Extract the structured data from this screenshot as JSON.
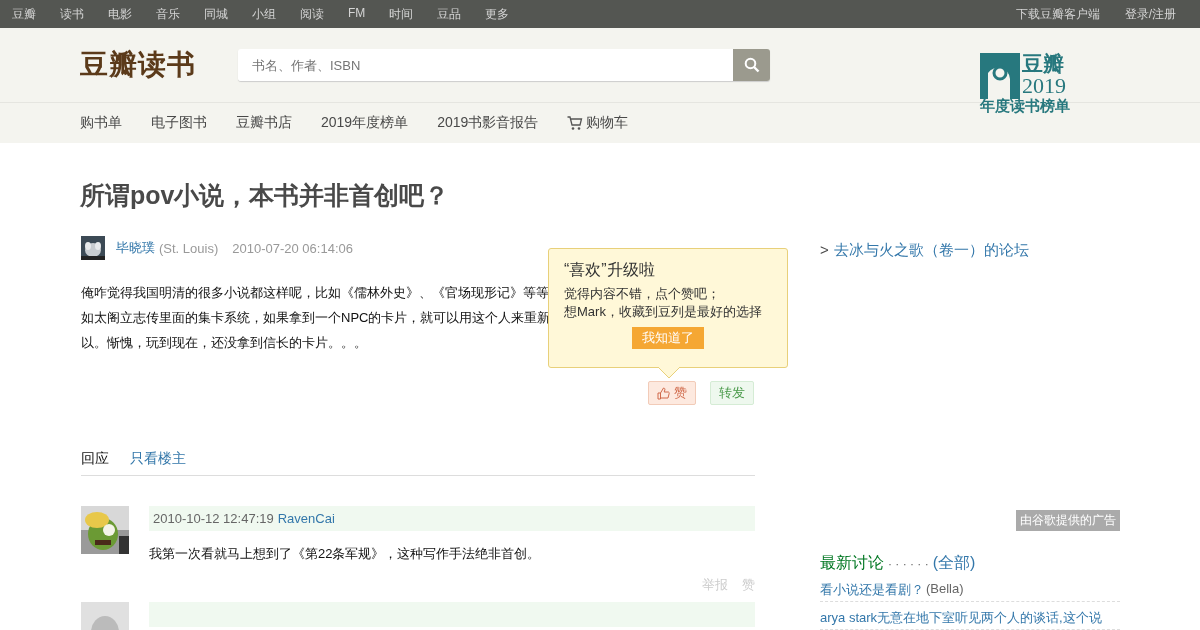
{
  "top_nav": {
    "items": [
      "豆瓣",
      "读书",
      "电影",
      "音乐",
      "同城",
      "小组",
      "阅读",
      "FM",
      "时间",
      "豆品",
      "更多"
    ],
    "right_links": [
      "下载豆瓣客户端",
      "登录/注册"
    ]
  },
  "header": {
    "logo": "豆瓣读书",
    "search": {
      "placeholder": "书名、作者、ISBN"
    },
    "badge": {
      "top": "豆瓣",
      "year": "2019",
      "bottom": "年度读书榜单"
    }
  },
  "sub_nav": [
    {
      "label": "购书单",
      "kind": "text"
    },
    {
      "label": "电子图书",
      "kind": "text"
    },
    {
      "label": "豆瓣书店",
      "kind": "text"
    },
    {
      "label": "2019年度榜单",
      "kind": "text"
    },
    {
      "label": "2019书影音报告",
      "kind": "text"
    },
    {
      "label": "购物车",
      "kind": "cart"
    }
  ],
  "topic": {
    "title": "所谓pov小说，本书并非首创吧？",
    "author": "毕晓璞",
    "location": "(St. Louis)",
    "time": "2010-07-20 06:14:06",
    "body_lines": [
      "俺咋觉得我国明清的很多小说都这样呢，比如《儒林外史》、《官场现形记》等等",
      "如太阁立志传里面的集卡系统，如果拿到一个NPC的卡片，就可以用这个人来重新",
      "以。惭愧，玩到现在，还没拿到信长的卡片。。。"
    ],
    "like": "赞",
    "share": "转发"
  },
  "tip": {
    "title": "“喜欢”升级啦",
    "lines": [
      "觉得内容不错，点个赞吧；",
      "想Mark，收藏到豆列是最好的选择"
    ],
    "button": "我知道了"
  },
  "tabs": [
    {
      "label": "回应",
      "selected": true
    },
    {
      "label": "只看楼主",
      "selected": false
    }
  ],
  "comments": [
    {
      "time": "2010-10-12 12:47:19",
      "user": "RavenCai",
      "text": "我第一次看就马上想到了《第22条军规》，这种写作手法绝非首创。",
      "actions": [
        "举报",
        "赞"
      ]
    }
  ],
  "sidebar": {
    "forum_prefix": ">",
    "forum_link": "去冰与火之歌（卷一）的论坛",
    "ad_label": "由谷歌提供的广告",
    "latest": {
      "title": "最新讨论",
      "dots": "· · · · · ·",
      "all": "(全部)",
      "items": [
        {
          "title": "看小说还是看剧？",
          "author": "(Bella)"
        },
        {
          "title": "arya stark无意在地下室听见两个人的谈话,这个说"
        }
      ]
    }
  }
}
